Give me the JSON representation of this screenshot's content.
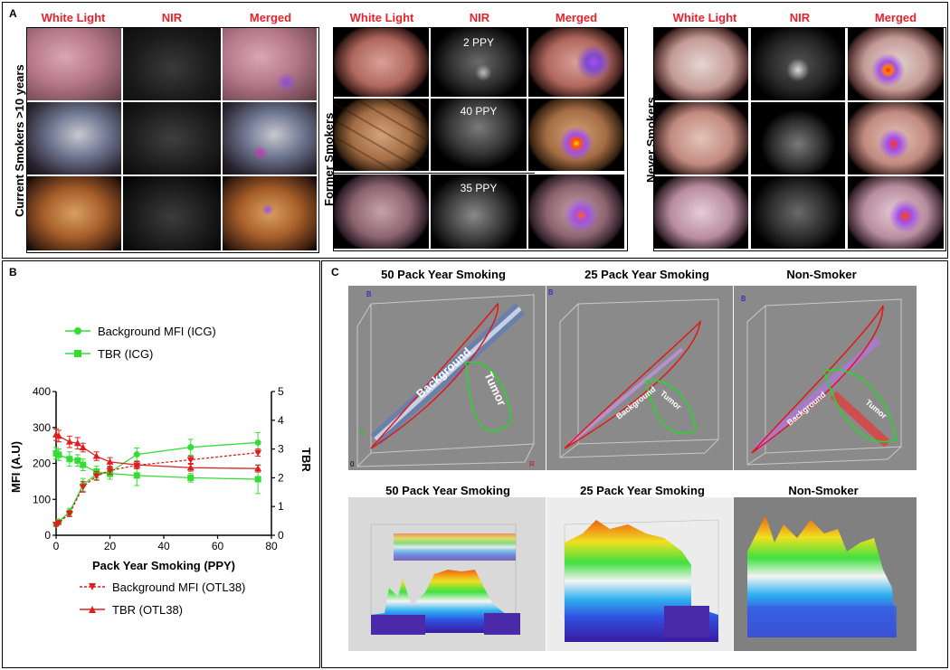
{
  "panelA": {
    "letter": "A",
    "headers": {
      "white": "White Light",
      "nir": "NIR",
      "merged": "Merged"
    },
    "groups": [
      "Current Smokers >10 years",
      "Former Smokers",
      "Never Smokers"
    ],
    "ppy_labels": [
      "2 PPY",
      "40 PPY",
      "35 PPY"
    ]
  },
  "panelB": {
    "letter": "B",
    "legend_top": [
      "Background MFI (ICG)",
      "TBR (ICG)"
    ],
    "legend_bottom": [
      "Background MFI (OTL38)",
      "TBR (OTL38)"
    ],
    "colors": {
      "icg": "#33dd33",
      "otl38": "#dd1f1f"
    }
  },
  "panelC": {
    "letter": "C",
    "titles_top": [
      "50 Pack Year Smoking",
      "25 Pack Year Smoking",
      "Non-Smoker"
    ],
    "titles_bottom": [
      "50 Pack Year Smoking",
      "25 Pack Year Smoking",
      "Non-Smoker"
    ],
    "region_labels": {
      "background": "Background",
      "tumor": "Tumor"
    },
    "axis_letters": {
      "b": "B",
      "g": "G",
      "r": "R",
      "o": "0"
    }
  },
  "chart_data": {
    "type": "line",
    "x": [
      0,
      1,
      5,
      10,
      15,
      20,
      30,
      50,
      75
    ],
    "xlabel": "Pack Year Smoking (PPY)",
    "ylabel": "MFI (A.U)",
    "y2label": "TBR",
    "xlim": [
      0,
      80
    ],
    "ylim": [
      0,
      400
    ],
    "y2lim": [
      0,
      5
    ],
    "xticks": [
      "0",
      "20",
      "40",
      "60",
      "80"
    ],
    "yticks": [
      "0",
      "100",
      "200",
      "300",
      "400"
    ],
    "y2ticks": [
      "0",
      "1",
      "2",
      "3",
      "4",
      "5"
    ],
    "series": [
      {
        "name": "Background MFI (ICG)",
        "axis": "left",
        "color": "#33dd33",
        "marker": "circle",
        "dashed": false,
        "x": [
          0,
          1,
          5,
          10,
          15,
          20,
          30,
          50,
          75
        ],
        "y": [
          30,
          38,
          65,
          140,
          170,
          175,
          225,
          245,
          258
        ],
        "err": [
          5,
          6,
          10,
          18,
          15,
          12,
          18,
          22,
          28
        ]
      },
      {
        "name": "TBR (ICG)",
        "axis": "right",
        "color": "#33dd33",
        "marker": "square",
        "dashed": false,
        "x": [
          0,
          1,
          5,
          8,
          10,
          15,
          20,
          30,
          50,
          75
        ],
        "y": [
          2.85,
          2.8,
          2.65,
          2.6,
          2.45,
          2.2,
          2.15,
          2.08,
          2.0,
          1.95
        ],
        "err": [
          0.2,
          0.2,
          0.25,
          0.2,
          0.2,
          0.2,
          0.2,
          0.35,
          0.15,
          0.5
        ]
      },
      {
        "name": "Background MFI (OTL38)",
        "axis": "left",
        "color": "#dd1f1f",
        "marker": "triangle-down",
        "dashed": true,
        "x": [
          0,
          1,
          5,
          10,
          15,
          20,
          30,
          50,
          75
        ],
        "y": [
          30,
          35,
          60,
          135,
          165,
          180,
          195,
          210,
          230
        ],
        "err": [
          5,
          5,
          8,
          15,
          12,
          10,
          10,
          10,
          10
        ]
      },
      {
        "name": "TBR (OTL38)",
        "axis": "right",
        "color": "#dd1f1f",
        "marker": "triangle-up",
        "dashed": false,
        "x": [
          0,
          1,
          5,
          8,
          10,
          15,
          20,
          30,
          50,
          75
        ],
        "y": [
          3.5,
          3.45,
          3.25,
          3.2,
          3.05,
          2.75,
          2.55,
          2.45,
          2.35,
          2.32
        ],
        "err": [
          0.2,
          0.2,
          0.2,
          0.2,
          0.15,
          0.15,
          0.15,
          0.12,
          0.12,
          0.12
        ]
      }
    ]
  }
}
